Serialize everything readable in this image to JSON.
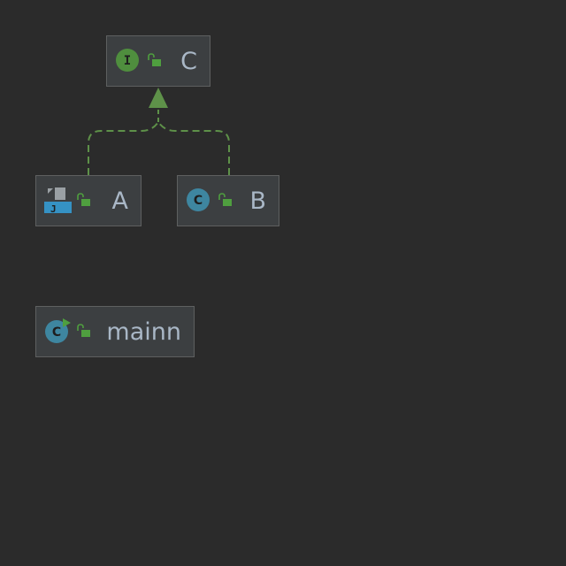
{
  "diagram": {
    "nodes": [
      {
        "id": "C",
        "label": "C",
        "kind": "interface",
        "visibility": "public",
        "kind_icon": "interface-icon"
      },
      {
        "id": "A",
        "label": "A",
        "kind": "java-file",
        "visibility": "public",
        "kind_icon": "java-file-icon"
      },
      {
        "id": "B",
        "label": "B",
        "kind": "class",
        "visibility": "public",
        "kind_icon": "class-icon"
      },
      {
        "id": "mainn",
        "label": "mainn",
        "kind": "runnable-class",
        "visibility": "public",
        "kind_icon": "runnable-class-icon"
      }
    ],
    "edges": [
      {
        "from": "A",
        "to": "C",
        "type": "implements",
        "style": "dashed"
      },
      {
        "from": "B",
        "to": "C",
        "type": "implements",
        "style": "dashed"
      }
    ]
  },
  "colors": {
    "background": "#2b2b2b",
    "node_fill": "#3c3f41",
    "node_border": "#5e6060",
    "label_text": "#a9b7c6",
    "edge": "#5e9149",
    "interface_badge": "#4f8e3e",
    "class_badge": "#3e86a0",
    "lock": "#4f9f3f"
  }
}
